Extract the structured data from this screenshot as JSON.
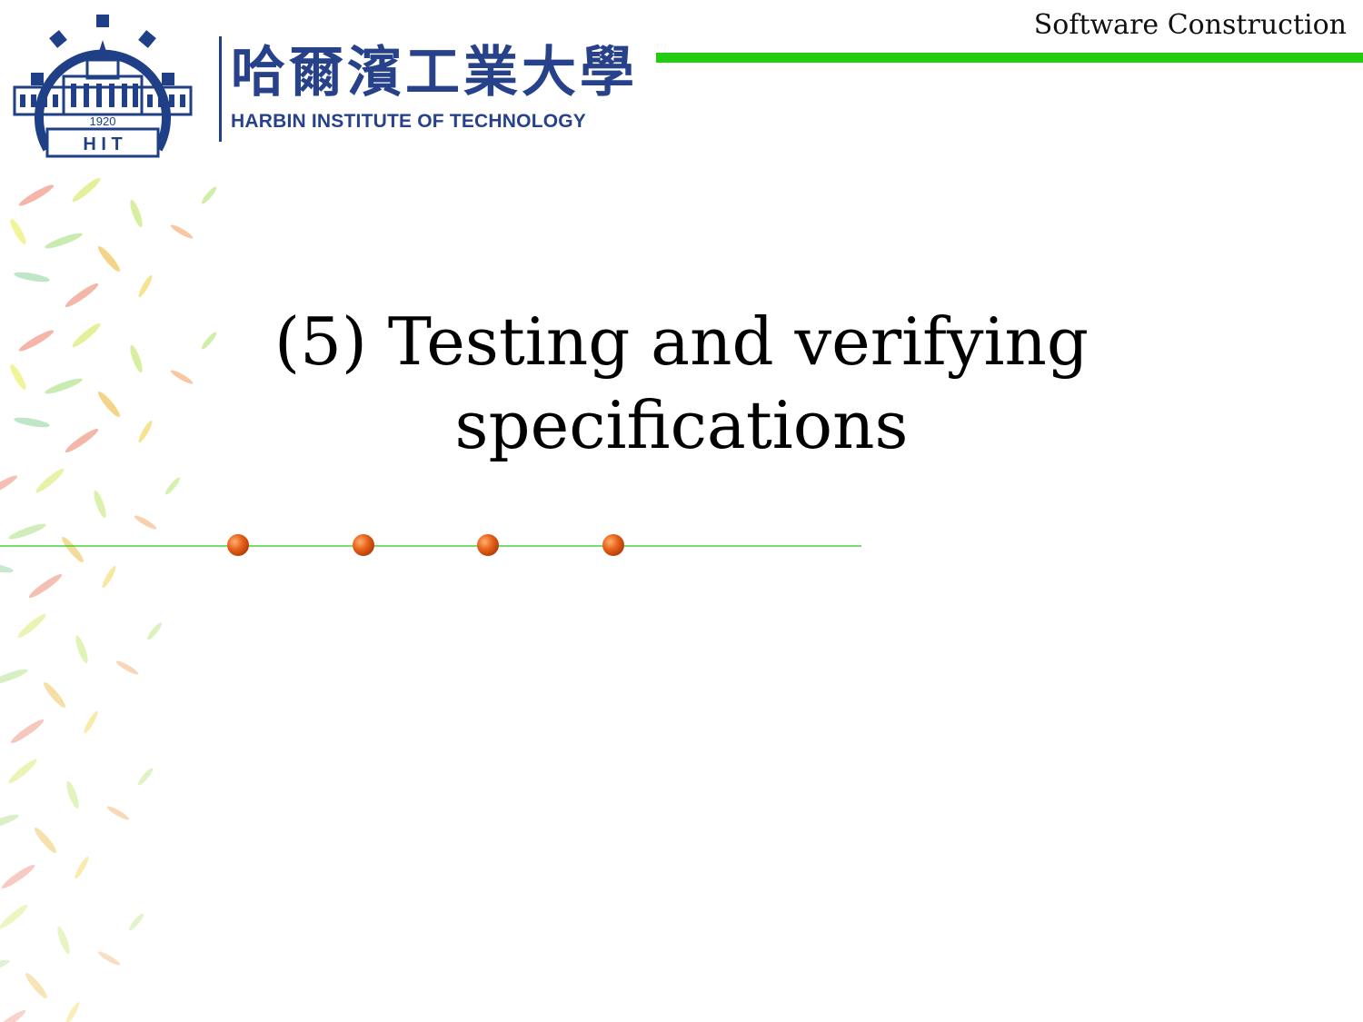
{
  "header": {
    "emblem_year": "1920",
    "emblem_letters": "H I T",
    "university_name_cn": "哈爾濱工業大學",
    "university_name_en": "HARBIN INSTITUTE OF TECHNOLOGY",
    "course_title": "Software Construction",
    "accent_color": "#22cc11",
    "brand_color": "#27418a"
  },
  "slide": {
    "title_line1": "(5) Testing and verifying",
    "title_line2": "specifications"
  },
  "divider": {
    "dot_count": 4,
    "dot_color": "#e8621a",
    "line_color": "#22cc11"
  }
}
